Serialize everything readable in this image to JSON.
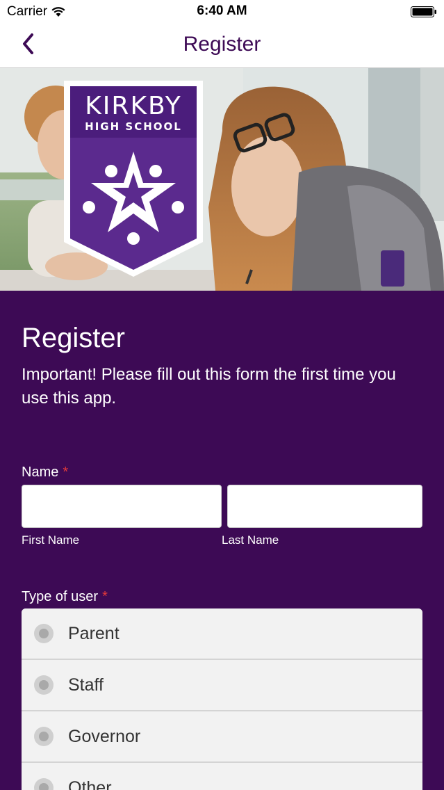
{
  "status_bar": {
    "carrier": "Carrier",
    "time": "6:40 AM"
  },
  "nav": {
    "title": "Register",
    "back_icon": "chevron-left-icon",
    "accent_color": "#3d0a55"
  },
  "hero": {
    "logo_line1": "KIRKBY",
    "logo_line2": "HIGH SCHOOL",
    "logo_color": "#5b2a8e"
  },
  "form": {
    "title": "Register",
    "intro": "Important! Please fill out this form the first time you use this app.",
    "name": {
      "label": "Name",
      "required_mark": "*",
      "first_name": {
        "value": "",
        "sub_label": "First Name"
      },
      "last_name": {
        "value": "",
        "sub_label": "Last Name"
      }
    },
    "user_type": {
      "label": "Type of user",
      "required_mark": "*",
      "options": [
        "Parent",
        "Staff",
        "Governor",
        "Other"
      ]
    }
  },
  "colors": {
    "background": "#3d0a55",
    "required": "#e23a3a"
  }
}
